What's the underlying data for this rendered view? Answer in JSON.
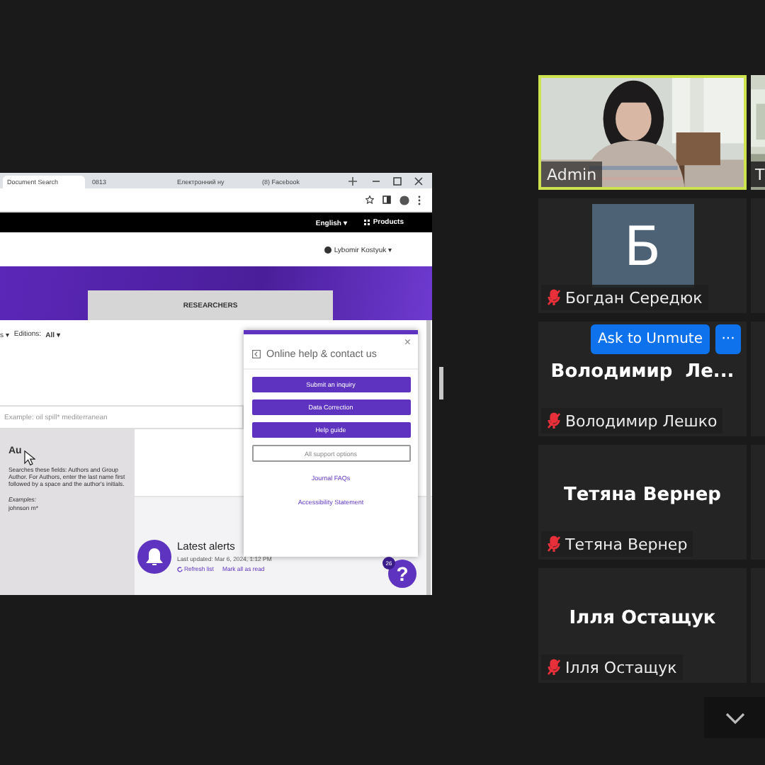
{
  "shared_screen": {
    "browser_tabs": [
      {
        "label": "Document Search",
        "selected": true
      },
      {
        "label": "0813",
        "selected": false
      },
      {
        "label": "Електронний ну",
        "selected": false
      },
      {
        "label": "(8) Facebook",
        "selected": false
      }
    ],
    "site_nav": {
      "language": "English ▾",
      "products": "Products"
    },
    "user_menu": "Lybomir Kostyuk ▾",
    "search_tabs": [
      {
        "label": "RESEARCHERS",
        "selected": false
      }
    ],
    "filters": {
      "collections": "s ▾",
      "editions_label": "Editions:",
      "editions_value": "All ▾"
    },
    "search_field": {
      "placeholder": "Example: oil spill* mediterranean"
    },
    "field_tooltip": {
      "title": "Au",
      "description": "Searches these fields: Authors and Group Author. For Authors, enter the last name first followed by a space and the author's initials.",
      "examples_label": "Examples:",
      "example": "johnson m*"
    },
    "alerts": {
      "title": "Latest alerts",
      "updated": "Last updated: Mar 6, 2024, 1:12 PM",
      "refresh": "Refresh list",
      "mark_read": "Mark all as read"
    },
    "help_panel": {
      "title": "Online help & contact us",
      "close": "×",
      "buttons": [
        {
          "label": "Submit an inquiry",
          "kind": "primary"
        },
        {
          "label": "Data Correction",
          "kind": "primary"
        },
        {
          "label": "Help guide",
          "kind": "primary"
        },
        {
          "label": "All support options",
          "kind": "outline"
        },
        {
          "label": "Journal FAQs",
          "kind": "link"
        },
        {
          "label": "Accessibility Statement",
          "kind": "link"
        }
      ]
    },
    "help_button": {
      "label": "?",
      "badge": "26"
    }
  },
  "participants": [
    {
      "name": "Admin",
      "kind": "video",
      "active_speaker": true,
      "muted": false
    },
    {
      "name": "Богдан Середюк",
      "kind": "avatar",
      "initial": "Б",
      "active_speaker": false,
      "muted": true
    },
    {
      "name": "Володимир Лешко",
      "kind": "name",
      "display_name": "Володимир  Ле...",
      "active_speaker": false,
      "muted": true,
      "actions": {
        "ask_unmute": "Ask to Unmute",
        "more": "···"
      }
    },
    {
      "name": "Тетяна Вернер",
      "kind": "name",
      "display_name": "Тетяна Вернер",
      "active_speaker": false,
      "muted": true
    },
    {
      "name": "Ілля Остащук",
      "kind": "name",
      "display_name": "Ілля Остащук",
      "active_speaker": false,
      "muted": true
    }
  ],
  "side_tiles": [
    {
      "kind": "video",
      "name": "Т"
    },
    {
      "kind": "blank"
    },
    {
      "kind": "blank"
    },
    {
      "kind": "blank"
    },
    {
      "kind": "blank"
    }
  ]
}
